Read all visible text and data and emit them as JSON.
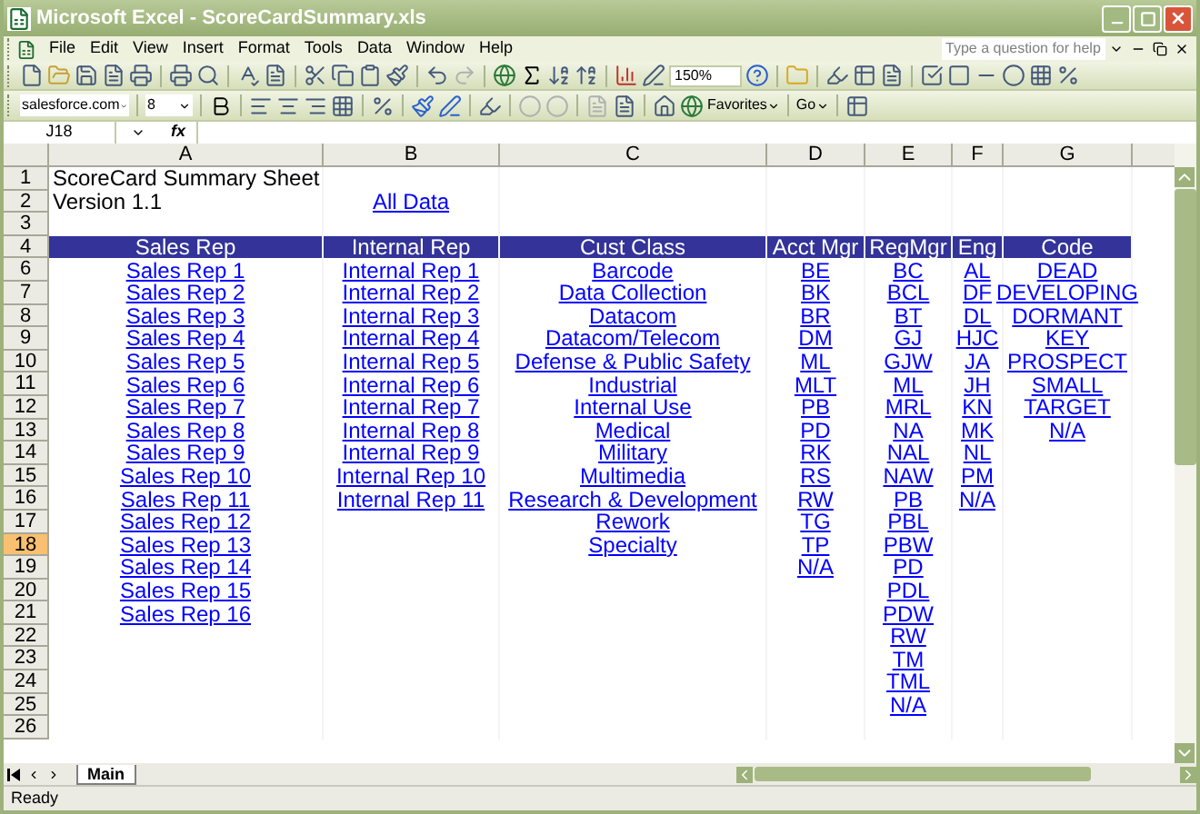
{
  "window": {
    "title": "Microsoft Excel - ScoreCardSummary.xls"
  },
  "menu": [
    "File",
    "Edit",
    "View",
    "Insert",
    "Format",
    "Tools",
    "Data",
    "Window",
    "Help"
  ],
  "help_field": {
    "placeholder": "Type a question for help"
  },
  "toolbar": {
    "zoom": "150%",
    "font": "salesforce.com",
    "font_size": "8",
    "favorites": "Favorites",
    "go": "Go"
  },
  "formula_bar": {
    "name_box": "J18",
    "function_label": "fx"
  },
  "columns": [
    {
      "label": "A",
      "selected": false
    },
    {
      "label": "B",
      "selected": false
    },
    {
      "label": "C",
      "selected": false
    },
    {
      "label": "D",
      "selected": false
    },
    {
      "label": "E",
      "selected": false
    },
    {
      "label": "F",
      "selected": false
    },
    {
      "label": "G",
      "selected": false
    }
  ],
  "rows": [
    {
      "number": "1",
      "selected": false,
      "kind": "plain",
      "cells": [
        {
          "text": "ScoreCard Summary Sheet",
          "kind": "text"
        },
        null,
        null,
        null,
        null,
        null,
        null
      ]
    },
    {
      "number": "2",
      "selected": false,
      "kind": "plain",
      "cells": [
        {
          "text": "Version 1.1",
          "kind": "text"
        },
        {
          "text": "All Data",
          "kind": "link"
        },
        null,
        null,
        null,
        null,
        null
      ]
    },
    {
      "number": "3",
      "selected": false,
      "kind": "plain",
      "cells": [
        null,
        null,
        null,
        null,
        null,
        null,
        null
      ]
    },
    {
      "number": "4",
      "selected": false,
      "kind": "header",
      "cells": [
        {
          "text": "Sales Rep",
          "kind": "header"
        },
        {
          "text": "Internal Rep",
          "kind": "header"
        },
        {
          "text": "Cust Class",
          "kind": "header"
        },
        {
          "text": "Acct Mgr",
          "kind": "header"
        },
        {
          "text": "RegMgr",
          "kind": "header"
        },
        {
          "text": "Eng",
          "kind": "header"
        },
        {
          "text": "Code",
          "kind": "header"
        }
      ]
    },
    {
      "number": "6",
      "selected": false,
      "kind": "plain",
      "cells": [
        {
          "text": "Sales Rep 1",
          "kind": "link"
        },
        {
          "text": "Internal Rep 1",
          "kind": "link"
        },
        {
          "text": "Barcode",
          "kind": "link"
        },
        {
          "text": "BE",
          "kind": "link"
        },
        {
          "text": "BC",
          "kind": "link"
        },
        {
          "text": "AL",
          "kind": "link"
        },
        {
          "text": "DEAD",
          "kind": "link"
        }
      ]
    },
    {
      "number": "7",
      "selected": false,
      "kind": "plain",
      "cells": [
        {
          "text": "Sales Rep 2",
          "kind": "link"
        },
        {
          "text": "Internal Rep 2",
          "kind": "link"
        },
        {
          "text": "Data Collection",
          "kind": "link"
        },
        {
          "text": "BK",
          "kind": "link"
        },
        {
          "text": "BCL",
          "kind": "link"
        },
        {
          "text": "DF",
          "kind": "link"
        },
        {
          "text": "DEVELOPING",
          "kind": "link"
        }
      ]
    },
    {
      "number": "8",
      "selected": false,
      "kind": "plain",
      "cells": [
        {
          "text": "Sales Rep 3",
          "kind": "link"
        },
        {
          "text": "Internal Rep 3",
          "kind": "link"
        },
        {
          "text": "Datacom",
          "kind": "link"
        },
        {
          "text": "BR",
          "kind": "link"
        },
        {
          "text": "BT",
          "kind": "link"
        },
        {
          "text": "DL",
          "kind": "link"
        },
        {
          "text": "DORMANT",
          "kind": "link"
        }
      ]
    },
    {
      "number": "9",
      "selected": false,
      "kind": "plain",
      "cells": [
        {
          "text": "Sales Rep 4",
          "kind": "link"
        },
        {
          "text": "Internal Rep 4",
          "kind": "link"
        },
        {
          "text": "Datacom/Telecom",
          "kind": "link"
        },
        {
          "text": "DM",
          "kind": "link"
        },
        {
          "text": "GJ",
          "kind": "link"
        },
        {
          "text": "HJC",
          "kind": "link"
        },
        {
          "text": "KEY",
          "kind": "link"
        }
      ]
    },
    {
      "number": "10",
      "selected": false,
      "kind": "plain",
      "cells": [
        {
          "text": "Sales Rep 5",
          "kind": "link"
        },
        {
          "text": "Internal Rep 5",
          "kind": "link"
        },
        {
          "text": "Defense & Public Safety",
          "kind": "link"
        },
        {
          "text": "ML",
          "kind": "link"
        },
        {
          "text": "GJW",
          "kind": "link"
        },
        {
          "text": "JA",
          "kind": "link"
        },
        {
          "text": "PROSPECT",
          "kind": "link"
        }
      ]
    },
    {
      "number": "11",
      "selected": false,
      "kind": "plain",
      "cells": [
        {
          "text": "Sales Rep 6",
          "kind": "link"
        },
        {
          "text": "Internal Rep 6",
          "kind": "link"
        },
        {
          "text": "Industrial",
          "kind": "link"
        },
        {
          "text": "MLT",
          "kind": "link"
        },
        {
          "text": "ML",
          "kind": "link"
        },
        {
          "text": "JH",
          "kind": "link"
        },
        {
          "text": "SMALL",
          "kind": "link"
        }
      ]
    },
    {
      "number": "12",
      "selected": false,
      "kind": "plain",
      "cells": [
        {
          "text": "Sales Rep 7",
          "kind": "link"
        },
        {
          "text": "Internal Rep 7",
          "kind": "link"
        },
        {
          "text": "Internal Use",
          "kind": "link"
        },
        {
          "text": "PB",
          "kind": "link"
        },
        {
          "text": "MRL",
          "kind": "link"
        },
        {
          "text": "KN",
          "kind": "link"
        },
        {
          "text": "TARGET",
          "kind": "link"
        }
      ]
    },
    {
      "number": "13",
      "selected": false,
      "kind": "plain",
      "cells": [
        {
          "text": "Sales Rep 8",
          "kind": "link"
        },
        {
          "text": "Internal Rep 8",
          "kind": "link"
        },
        {
          "text": "Medical",
          "kind": "link"
        },
        {
          "text": "PD",
          "kind": "link"
        },
        {
          "text": "NA",
          "kind": "link"
        },
        {
          "text": "MK",
          "kind": "link"
        },
        {
          "text": "N/A",
          "kind": "link"
        }
      ]
    },
    {
      "number": "14",
      "selected": false,
      "kind": "plain",
      "cells": [
        {
          "text": "Sales Rep 9",
          "kind": "link"
        },
        {
          "text": "Internal Rep 9",
          "kind": "link"
        },
        {
          "text": "Military",
          "kind": "link"
        },
        {
          "text": "RK",
          "kind": "link"
        },
        {
          "text": "NAL",
          "kind": "link"
        },
        {
          "text": "NL",
          "kind": "link"
        },
        null
      ]
    },
    {
      "number": "15",
      "selected": false,
      "kind": "plain",
      "cells": [
        {
          "text": "Sales Rep 10",
          "kind": "link"
        },
        {
          "text": "Internal Rep 10",
          "kind": "link"
        },
        {
          "text": "Multimedia",
          "kind": "link"
        },
        {
          "text": "RS",
          "kind": "link"
        },
        {
          "text": "NAW",
          "kind": "link"
        },
        {
          "text": "PM",
          "kind": "link"
        },
        null
      ]
    },
    {
      "number": "16",
      "selected": false,
      "kind": "plain",
      "cells": [
        {
          "text": "Sales Rep 11",
          "kind": "link"
        },
        {
          "text": "Internal Rep 11",
          "kind": "link"
        },
        {
          "text": "Research & Development",
          "kind": "link"
        },
        {
          "text": "RW",
          "kind": "link"
        },
        {
          "text": "PB",
          "kind": "link"
        },
        {
          "text": "N/A",
          "kind": "link"
        },
        null
      ]
    },
    {
      "number": "17",
      "selected": false,
      "kind": "plain",
      "cells": [
        {
          "text": "Sales Rep 12",
          "kind": "link"
        },
        null,
        {
          "text": "Rework",
          "kind": "link"
        },
        {
          "text": "TG",
          "kind": "link"
        },
        {
          "text": "PBL",
          "kind": "link"
        },
        null,
        null
      ]
    },
    {
      "number": "18",
      "selected": true,
      "kind": "plain",
      "cells": [
        {
          "text": "Sales Rep 13",
          "kind": "link"
        },
        null,
        {
          "text": "Specialty",
          "kind": "link"
        },
        {
          "text": "TP",
          "kind": "link"
        },
        {
          "text": "PBW",
          "kind": "link"
        },
        null,
        null
      ]
    },
    {
      "number": "19",
      "selected": false,
      "kind": "plain",
      "cells": [
        {
          "text": "Sales Rep 14",
          "kind": "link"
        },
        null,
        null,
        {
          "text": "N/A",
          "kind": "link"
        },
        {
          "text": "PD",
          "kind": "link"
        },
        null,
        null
      ]
    },
    {
      "number": "20",
      "selected": false,
      "kind": "plain",
      "cells": [
        {
          "text": "Sales Rep 15",
          "kind": "link"
        },
        null,
        null,
        null,
        {
          "text": "PDL",
          "kind": "link"
        },
        null,
        null
      ]
    },
    {
      "number": "21",
      "selected": false,
      "kind": "plain",
      "cells": [
        {
          "text": "Sales Rep 16",
          "kind": "link"
        },
        null,
        null,
        null,
        {
          "text": "PDW",
          "kind": "link"
        },
        null,
        null
      ]
    },
    {
      "number": "22",
      "selected": false,
      "kind": "plain",
      "cells": [
        null,
        null,
        null,
        null,
        {
          "text": "RW",
          "kind": "link"
        },
        null,
        null
      ]
    },
    {
      "number": "23",
      "selected": false,
      "kind": "plain",
      "cells": [
        null,
        null,
        null,
        null,
        {
          "text": "TM",
          "kind": "link"
        },
        null,
        null
      ]
    },
    {
      "number": "24",
      "selected": false,
      "kind": "plain",
      "cells": [
        null,
        null,
        null,
        null,
        {
          "text": "TML",
          "kind": "link"
        },
        null,
        null
      ]
    },
    {
      "number": "25",
      "selected": false,
      "kind": "plain",
      "cells": [
        null,
        null,
        null,
        null,
        {
          "text": "N/A",
          "kind": "link"
        },
        null,
        null
      ]
    },
    {
      "number": "26",
      "selected": false,
      "kind": "plain",
      "cells": [
        null,
        null,
        null,
        null,
        null,
        null,
        null
      ]
    }
  ],
  "sheet_tabs": [
    {
      "label": "Main",
      "selected": true
    }
  ],
  "status_bar": {
    "text": "Ready"
  }
}
